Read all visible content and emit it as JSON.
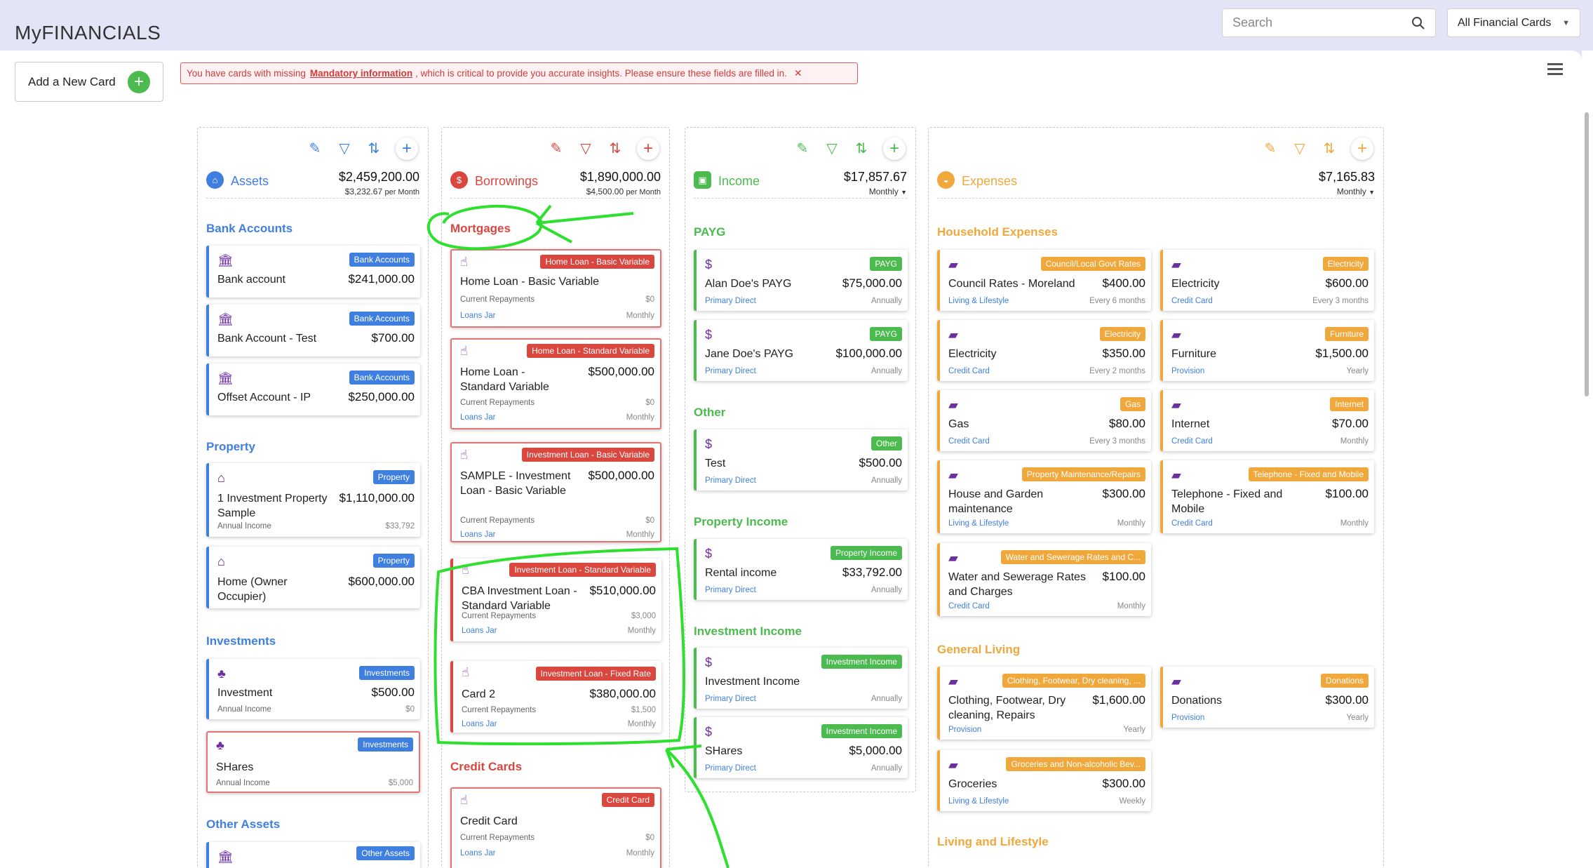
{
  "app": {
    "title": "MyFINANCIALS"
  },
  "header": {
    "search_placeholder": "Search",
    "filter_label": "All Financial Cards"
  },
  "toolbar": {
    "add_card_label": "Add a New Card"
  },
  "alert": {
    "text_before": "You have cards with missing",
    "link": "Mandatory information",
    "text_after": ", which is critical to provide you accurate insights. Please ensure these fields are filled in."
  },
  "colors": {
    "assets": "#3f7fe0",
    "borrowings": "#d9473f",
    "income": "#4cbb4f",
    "expenses": "#f0a83c"
  },
  "assets": {
    "title": "Assets",
    "total": "$2,459,200.00",
    "sub_amount": "$3,232.67",
    "sub_unit": "per Month",
    "sections": {
      "bank": "Bank Accounts",
      "property": "Property",
      "investments": "Investments",
      "other": "Other Assets"
    },
    "cards": [
      {
        "badge": "Bank Accounts",
        "name": "Bank account",
        "amount": "$241,000.00"
      },
      {
        "badge": "Bank Accounts",
        "name": "Bank Account - Test",
        "amount": "$700.00"
      },
      {
        "badge": "Bank Accounts",
        "name": "Offset Account - IP",
        "amount": "$250,000.00"
      },
      {
        "badge": "Property",
        "name": "1 Investment Property Sample",
        "amount": "$1,110,000.00",
        "meta_l": "Annual Income",
        "meta_r": "$33,792"
      },
      {
        "badge": "Property",
        "name": "Home (Owner Occupier)",
        "amount": "$600,000.00"
      },
      {
        "badge": "Investments",
        "name": "Investment",
        "amount": "$500.00",
        "meta_l": "Annual Income",
        "meta_r": "$0"
      },
      {
        "badge": "Investments",
        "name": "SHares",
        "amount": "",
        "meta_l": "Annual Income",
        "meta_r": "$5,000"
      },
      {
        "badge": "Other Assets"
      }
    ]
  },
  "borrowings": {
    "title": "Borrowings",
    "total": "$1,890,000.00",
    "sub_amount": "$4,500.00",
    "sub_unit": "per Month",
    "sections": {
      "mortgages": "Mortgages",
      "credit": "Credit Cards"
    },
    "cards": [
      {
        "badge": "Home Loan - Basic Variable",
        "name": "Home Loan - Basic Variable",
        "amount": "",
        "repay_label": "Current Repayments",
        "repay": "$0",
        "jar": "Loans Jar",
        "freq": "Monthly"
      },
      {
        "badge": "Home Loan - Standard Variable",
        "name": "Home Loan - Standard Variable",
        "amount": "$500,000.00",
        "repay_label": "Current Repayments",
        "repay": "$0",
        "jar": "Loans Jar",
        "freq": "Monthly"
      },
      {
        "badge": "Investment Loan - Basic Variable",
        "name": "SAMPLE - Investment Loan - Basic Variable",
        "amount": "$500,000.00",
        "repay_label": "Current Repayments",
        "repay": "$0",
        "jar": "Loans Jar",
        "freq": "Monthly"
      },
      {
        "badge": "Investment Loan - Standard Variable",
        "name": "CBA Investment Loan - Standard Variable",
        "amount": "$510,000.00",
        "repay_label": "Current Repayments",
        "repay": "$3,000",
        "jar": "Loans Jar",
        "freq": "Monthly"
      },
      {
        "badge": "Investment Loan - Fixed Rate",
        "name": "Card 2",
        "amount": "$380,000.00",
        "repay_label": "Current Repayments",
        "repay": "$1,500",
        "jar": "Loans Jar",
        "freq": "Monthly"
      },
      {
        "badge": "Credit Card",
        "name": "Credit Card",
        "amount": "",
        "repay_label": "Current Repayments",
        "repay": "$0",
        "jar": "Loans Jar",
        "freq": "Monthly"
      }
    ]
  },
  "income": {
    "title": "Income",
    "total": "$17,857.67",
    "period": "Monthly",
    "sections": {
      "payg": "PAYG",
      "other": "Other",
      "property": "Property Income",
      "investment": "Investment Income"
    },
    "cards": [
      {
        "badge": "PAYG",
        "name": "Alan Doe's PAYG",
        "amount": "$75,000.00",
        "link": "Primary Direct",
        "freq": "Annually"
      },
      {
        "badge": "PAYG",
        "name": "Jane Doe's PAYG",
        "amount": "$100,000.00",
        "link": "Primary Direct",
        "freq": "Annually"
      },
      {
        "badge": "Other",
        "name": "Test",
        "amount": "$500.00",
        "link": "Primary Direct",
        "freq": "Annually"
      },
      {
        "badge": "Property Income",
        "name": "Rental income",
        "amount": "$33,792.00",
        "link": "Primary Direct",
        "freq": "Annually"
      },
      {
        "badge": "Investment Income",
        "name": "Investment Income",
        "amount": "",
        "link": "Primary Direct",
        "freq": "Annually"
      },
      {
        "badge": "Investment Income",
        "name": "SHares",
        "amount": "$5,000.00",
        "link": "Primary Direct",
        "freq": "Annually"
      }
    ]
  },
  "expenses": {
    "title": "Expenses",
    "total": "$7,165.83",
    "period": "Monthly",
    "sections": {
      "household": "Household Expenses",
      "general": "General Living",
      "lifestyle": "Living and Lifestyle"
    },
    "cards": [
      {
        "badge": "Council/Local Govt Rates",
        "name": "Council Rates - Moreland",
        "amount": "$400.00",
        "link": "Living & Lifestyle",
        "freq": "Every 6 months"
      },
      {
        "badge": "Electricity",
        "name": "Electricity",
        "amount": "$600.00",
        "link": "Credit Card",
        "freq": "Every 3 months"
      },
      {
        "badge": "Electricity",
        "name": "Electricity",
        "amount": "$350.00",
        "link": "Credit Card",
        "freq": "Every 2 months"
      },
      {
        "badge": "Furniture",
        "name": "Furniture",
        "amount": "$1,500.00",
        "link": "Provision",
        "freq": "Yearly"
      },
      {
        "badge": "Gas",
        "name": "Gas",
        "amount": "$80.00",
        "link": "Credit Card",
        "freq": "Every 3 months"
      },
      {
        "badge": "Internet",
        "name": "Internet",
        "amount": "$70.00",
        "link": "Credit Card",
        "freq": "Monthly"
      },
      {
        "badge": "Property Maintenance/Repairs",
        "name": "House and Garden maintenance",
        "amount": "$300.00",
        "link": "Living & Lifestyle",
        "freq": "Monthly"
      },
      {
        "badge": "Telephone - Fixed and Mobile",
        "name": "Telephone - Fixed and Mobile",
        "amount": "$100.00",
        "link": "Credit Card",
        "freq": "Monthly"
      },
      {
        "badge": "Water and Sewerage Rates and C...",
        "name": "Water and Sewerage Rates and Charges",
        "amount": "$100.00",
        "link": "Credit Card",
        "freq": "Monthly"
      },
      {
        "badge": "Clothing, Footwear, Dry cleaning, ...",
        "name": "Clothing, Footwear, Dry cleaning, Repairs",
        "amount": "$1,600.00",
        "link": "Provision",
        "freq": "Yearly"
      },
      {
        "badge": "Donations",
        "name": "Donations",
        "amount": "$300.00",
        "link": "Provision",
        "freq": "Yearly"
      },
      {
        "badge": "Groceries and Non-alcoholic Bev...",
        "name": "Groceries",
        "amount": "$300.00",
        "link": "Living & Lifestyle",
        "freq": "Weekly"
      }
    ]
  }
}
